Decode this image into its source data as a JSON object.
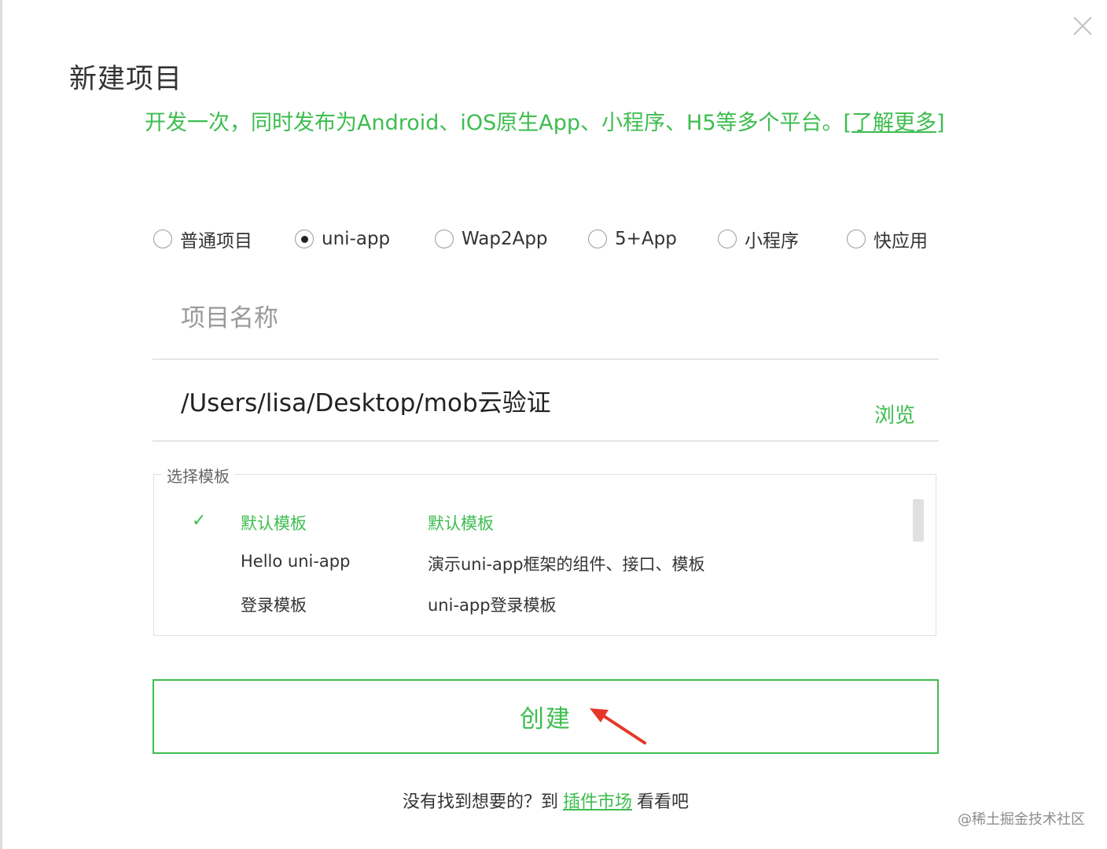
{
  "dialog": {
    "title": "新建项目",
    "subtitle_text": "开发一次，同时发布为Android、iOS原生App、小程序、H5等多个平台。",
    "subtitle_link": "[了解更多]",
    "close_icon": "close-icon"
  },
  "project_types": [
    {
      "label": "普通项目",
      "selected": false
    },
    {
      "label": "uni-app",
      "selected": true
    },
    {
      "label": "Wap2App",
      "selected": false
    },
    {
      "label": "5+App",
      "selected": false
    },
    {
      "label": "小程序",
      "selected": false
    },
    {
      "label": "快应用",
      "selected": false
    }
  ],
  "project_name": {
    "value": "",
    "placeholder": "项目名称"
  },
  "project_path": {
    "value": "/Users/lisa/Desktop/mob云验证",
    "browse_label": "浏览"
  },
  "templates": {
    "legend": "选择模板",
    "items": [
      {
        "check": "✓",
        "name": "默认模板",
        "desc": "默认模板",
        "selected": true
      },
      {
        "check": "",
        "name": "Hello uni-app",
        "desc": "演示uni-app框架的组件、接口、模板",
        "selected": false
      },
      {
        "check": "",
        "name": "登录模板",
        "desc": "uni-app登录模板",
        "selected": false
      }
    ]
  },
  "create_button": {
    "label": "创建"
  },
  "footer": {
    "prefix": "没有找到想要的？到",
    "link": "插件市场",
    "suffix": "看看吧"
  },
  "watermark": "@稀土掘金技术社区",
  "colors": {
    "accent": "#3dbd4f",
    "arrow": "#e8362b"
  }
}
